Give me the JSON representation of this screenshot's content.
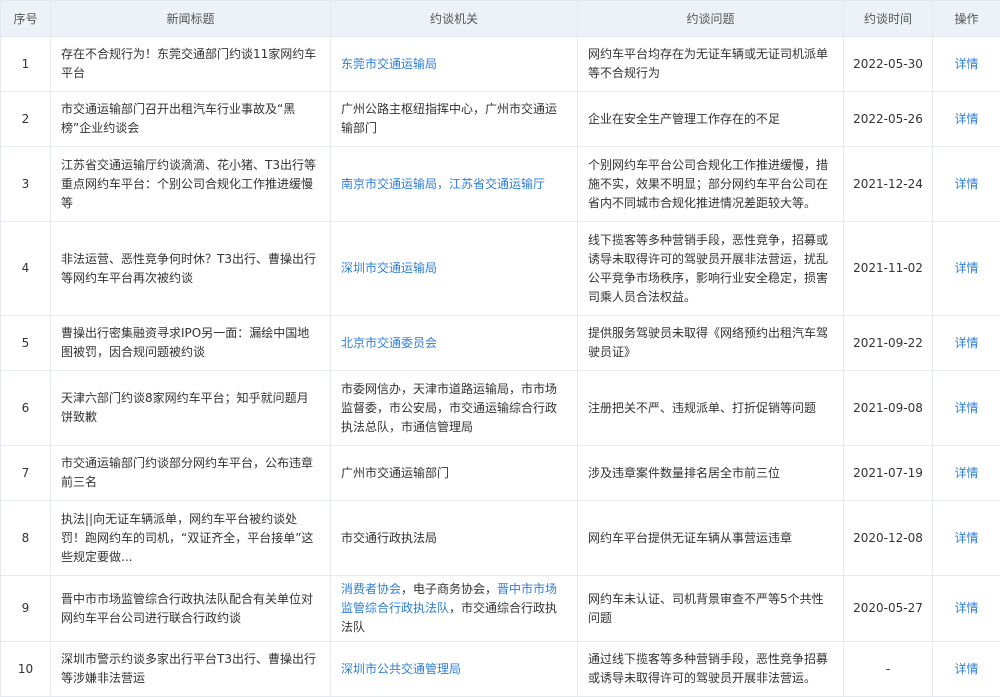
{
  "headers": [
    "序号",
    "新闻标题",
    "约谈机关",
    "约谈问题",
    "约谈时间",
    "操作"
  ],
  "colors": {
    "link": "#2f7fd6",
    "header_bg": "#edf2f8",
    "border": "#e6e9ef"
  },
  "rows": [
    {
      "no": "1",
      "title": "存在不合规行为！东莞交通部门约谈11家网约车平台",
      "agency": [
        {
          "text": "东莞市交通运输局",
          "link": true
        }
      ],
      "issue": "网约车平台均存在为无证车辆或无证司机派单等不合规行为",
      "date": "2022-05-30",
      "action": "详情",
      "h": 55
    },
    {
      "no": "2",
      "title": "市交通运输部门召开出租汽车行业事故及“黑榜”企业约谈会",
      "agency": [
        {
          "text": "广州公路主枢纽指挥中心，广州市交通运输部门",
          "link": false
        }
      ],
      "issue": "企业在安全生产管理工作存在的不足",
      "date": "2022-05-26",
      "action": "详情",
      "h": 55
    },
    {
      "no": "3",
      "title": "江苏省交通运输厅约谈滴滴、花小猪、T3出行等重点网约车平台：个别公司合规化工作推进缓慢等",
      "agency": [
        {
          "text": "南京市交通运输局，江苏省交通运输厅",
          "link": true
        }
      ],
      "issue": "个别网约车平台公司合规化工作推进缓慢，措施不实，效果不明显；部分网约车平台公司在省内不同城市合规化推进情况差距较大等。",
      "date": "2021-12-24",
      "action": "详情",
      "h": 75
    },
    {
      "no": "4",
      "title": "非法运营、恶性竞争何时休？T3出行、曹操出行等网约车平台再次被约谈",
      "agency": [
        {
          "text": "深圳市交通运输局",
          "link": true
        }
      ],
      "issue": "线下揽客等多种营销手段，恶性竞争，招募或诱导未取得许可的驾驶员开展非法营运，扰乱公平竞争市场秩序，影响行业安全稳定，损害司乘人员合法权益。",
      "date": "2021-11-02",
      "action": "详情",
      "h": 94
    },
    {
      "no": "5",
      "title": "曹操出行密集融资寻求IPO另一面：漏绘中国地图被罚，因合规问题被约谈",
      "agency": [
        {
          "text": "北京市交通委员会",
          "link": true
        }
      ],
      "issue": "提供服务驾驶员未取得《网络预约出租汽车驾驶员证》",
      "date": "2021-09-22",
      "action": "详情",
      "h": 55
    },
    {
      "no": "6",
      "title": "天津六部门约谈8家网约车平台；知乎就问题月饼致歉",
      "agency": [
        {
          "text": "市委网信办，天津市道路运输局，市市场监督委，市公安局，市交通运输综合行政执法总队，市通信管理局",
          "link": false
        }
      ],
      "issue": "注册把关不严、违规派单、打折促销等问题",
      "date": "2021-09-08",
      "action": "详情",
      "h": 75
    },
    {
      "no": "7",
      "title": "市交通运输部门约谈部分网约车平台，公布违章前三名",
      "agency": [
        {
          "text": "广州市交通运输部门",
          "link": false
        }
      ],
      "issue": "涉及违章案件数量排名居全市前三位",
      "date": "2021-07-19",
      "action": "详情",
      "h": 55
    },
    {
      "no": "8",
      "title": "执法||向无证车辆派单，网约车平台被约谈处罚！跑网约车的司机，“双证齐全，平台接单”这些规定要做...",
      "agency": [
        {
          "text": "市交通行政执法局",
          "link": false
        }
      ],
      "issue": "网约车平台提供无证车辆从事营运违章",
      "date": "2020-12-08",
      "action": "详情",
      "h": 75
    },
    {
      "no": "9",
      "title": "晋中市市场监管综合行政执法队配合有关单位对网约车平台公司进行联合行政约谈",
      "agency": [
        {
          "text": "消费者协会",
          "link": true
        },
        {
          "text": "，电子商务协会，",
          "link": false
        },
        {
          "text": "晋中市市场监管综合行政执法队",
          "link": true
        },
        {
          "text": "，市交通综合行政执法队",
          "link": false
        }
      ],
      "issue": "网约车未认证、司机背景审查不严等5个共性问题",
      "date": "2020-05-27",
      "action": "详情",
      "h": 55
    },
    {
      "no": "10",
      "title": "深圳市警示约谈多家出行平台T3出行、曹操出行等涉嫌非法营运",
      "agency": [
        {
          "text": "深圳市公共交通管理局",
          "link": true
        }
      ],
      "issue": "通过线下揽客等多种营销手段，恶性竞争招募或诱导未取得许可的驾驶员开展非法营运。",
      "date": "-",
      "action": "详情",
      "h": 55
    }
  ]
}
